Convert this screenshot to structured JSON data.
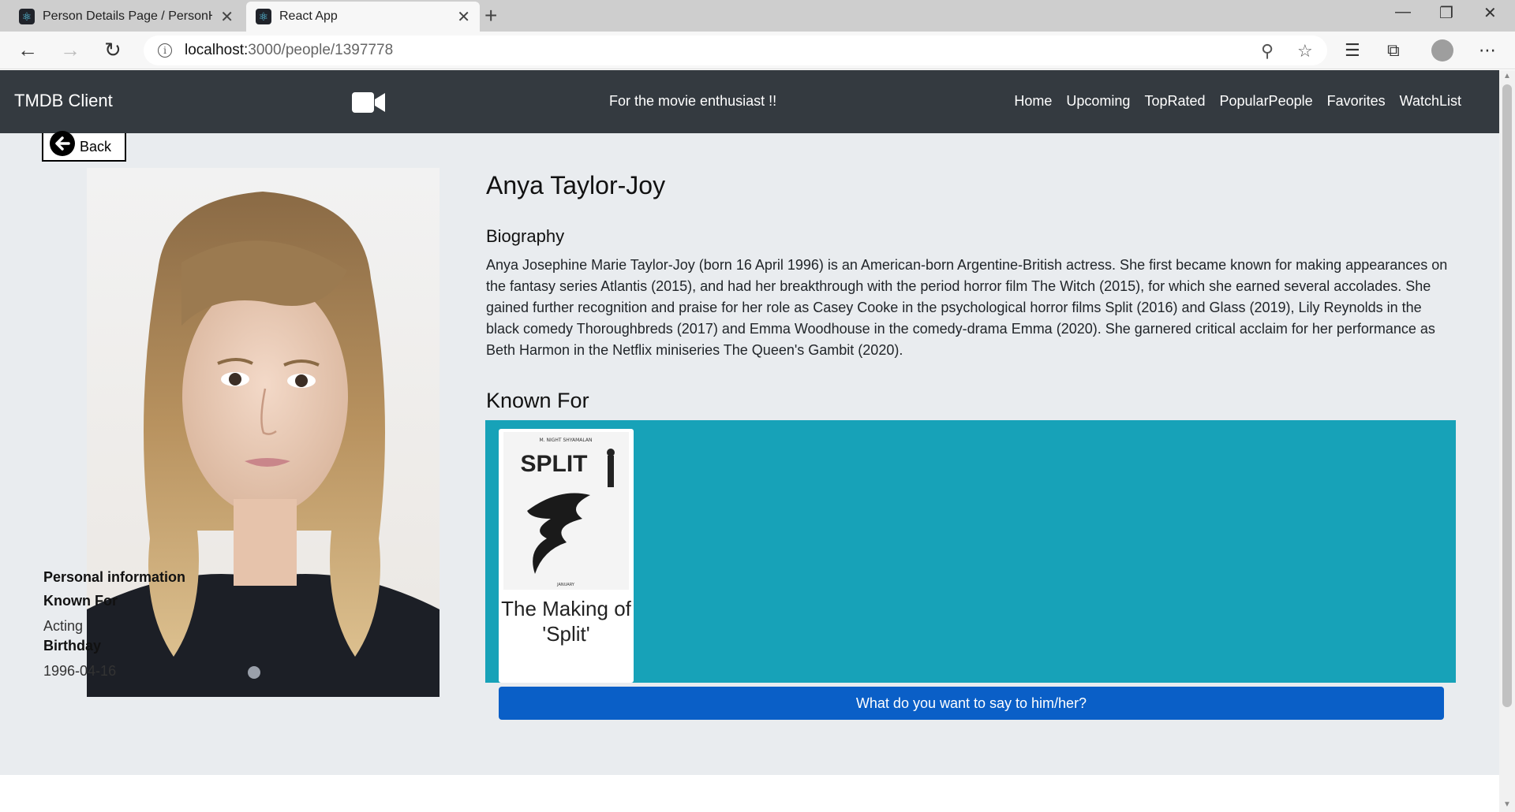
{
  "browser": {
    "tabs": [
      {
        "label": "Person Details Page / PersonHea",
        "active": false
      },
      {
        "label": "React App",
        "active": true
      }
    ],
    "url_host": "localhost:",
    "url_path": "3000/people/1397778"
  },
  "app": {
    "brand": "TMDB Client",
    "tagline": "For the movie enthusiast !!",
    "nav": [
      "Home",
      "Upcoming",
      "TopRated",
      "PopularPeople",
      "Favorites",
      "WatchList"
    ]
  },
  "back_label": "Back",
  "person": {
    "name": "Anya Taylor-Joy",
    "biography_heading": "Biography",
    "biography": "Anya Josephine Marie Taylor-Joy (born 16 April 1996) is an American-born Argentine-British actress. She first became known for making appearances on the fantasy series Atlantis (2015), and had her breakthrough with the period horror film The Witch (2015), for which she earned several accolades. She gained further recognition and praise for her role as Casey Cooke in the psychological horror films Split (2016) and Glass (2019), Lily Reynolds in the black comedy Thoroughbreds (2017) and Emma Woodhouse in the comedy-drama Emma (2020). She garnered critical acclaim for her performance as Beth Harmon in the Netflix miniseries The Queen's Gambit (2020).",
    "known_for_heading": "Known For",
    "personal_info_heading": "Personal information",
    "known_for_label": "Known For",
    "known_for_value": "Acting",
    "birthday_label": "Birthday",
    "birthday_value": "1996-04-16"
  },
  "known_for_movies": [
    {
      "title": "The Making of 'Split'",
      "poster_title": "SPLIT",
      "poster_director": "M. NIGHT SHYAMALAN",
      "poster_footer": "JANUARY"
    }
  ],
  "message_button": "What do you want to say to him/her?",
  "colors": {
    "navbar": "#343a40",
    "page_bg": "#e9ecef",
    "known_panel": "#17a2b8",
    "button": "#0a5fc7"
  }
}
